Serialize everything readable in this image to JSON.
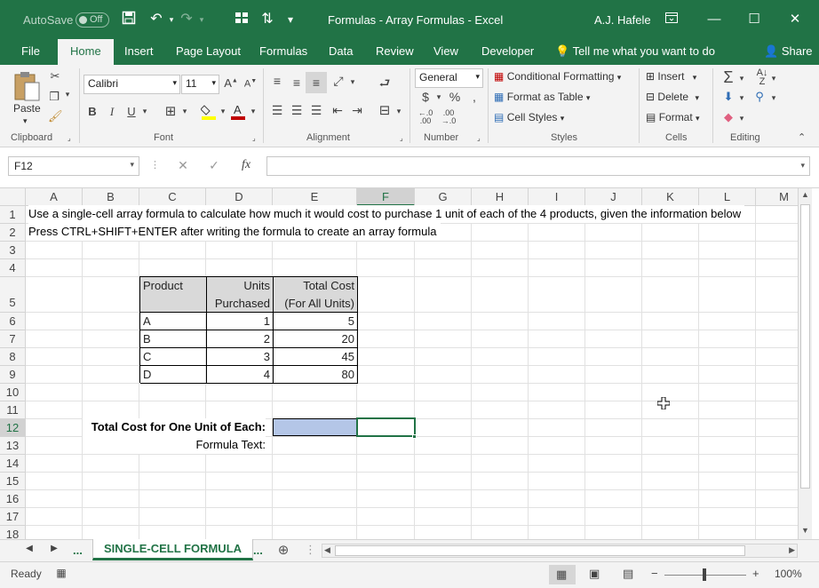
{
  "titlebar": {
    "autosave_label": "AutoSave",
    "autosave_state": "Off",
    "document_title": "Formulas - Array Formulas  -  Excel",
    "user_name": "A.J. Hafele",
    "accent_color": "#217346"
  },
  "ribbon_tabs": [
    "File",
    "Home",
    "Insert",
    "Page Layout",
    "Formulas",
    "Data",
    "Review",
    "Developer"
  ],
  "active_tab": "Home",
  "tell_me_placeholder": "Tell me what you want to do",
  "share_label": "Share",
  "ribbon": {
    "clipboard": {
      "paste_label": "Paste",
      "group_label": "Clipboard"
    },
    "font": {
      "font_name": "Calibri",
      "font_size": "11",
      "group_label": "Font"
    },
    "alignment": {
      "group_label": "Alignment"
    },
    "number": {
      "format": "General",
      "currency": "$",
      "percent": "%",
      "group_label": "Number"
    },
    "styles": {
      "conditional_formatting": "Conditional Formatting",
      "format_as_table": "Format as Table",
      "cell_styles": "Cell Styles",
      "group_label": "Styles"
    },
    "cells": {
      "insert": "Insert",
      "delete": "Delete",
      "format": "Format",
      "group_label": "Cells"
    },
    "editing": {
      "group_label": "Editing"
    }
  },
  "formula_bar": {
    "name_box": "F12",
    "fx_label": "fx",
    "formula": ""
  },
  "columns": [
    "A",
    "B",
    "C",
    "D",
    "E",
    "F",
    "G",
    "H",
    "I",
    "J",
    "K",
    "L",
    "M"
  ],
  "selected_column": "F",
  "rows": [
    "1",
    "2",
    "3",
    "4",
    "5",
    "6",
    "7",
    "8",
    "9",
    "10",
    "11",
    "12",
    "13",
    "14",
    "15",
    "16",
    "17",
    "18"
  ],
  "selected_row": "12",
  "sheet": {
    "row1_text": "Use a single-cell array formula to calculate how much it would cost to purchase 1 unit of each of the 4 products, given the information below",
    "row2_text": "Press CTRL+SHIFT+ENTER after writing the formula to create an array formula",
    "table": {
      "headers": [
        {
          "line1": "Product",
          "line2": ""
        },
        {
          "line1": "Units",
          "line2": "Purchased"
        },
        {
          "line1": "Total Cost",
          "line2": "(For All Units)"
        }
      ],
      "rows": [
        {
          "product": "A",
          "units": "1",
          "cost": "5"
        },
        {
          "product": "B",
          "units": "2",
          "cost": "20"
        },
        {
          "product": "C",
          "units": "3",
          "cost": "45"
        },
        {
          "product": "D",
          "units": "4",
          "cost": "80"
        }
      ]
    },
    "total_label": "Total Cost for One Unit of Each:",
    "formula_text_label": "Formula Text:"
  },
  "sheet_tabs": {
    "nav_ellipsis": "...",
    "active": "SINGLE-CELL FORMULA"
  },
  "statusbar": {
    "status": "Ready",
    "zoom": "100%"
  }
}
